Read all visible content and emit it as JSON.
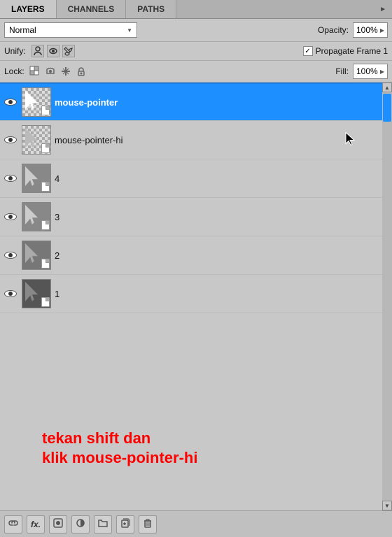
{
  "tabs": [
    {
      "id": "layers",
      "label": "LAYERS",
      "active": true
    },
    {
      "id": "channels",
      "label": "CHANNELS",
      "active": false
    },
    {
      "id": "paths",
      "label": "PATHS",
      "active": false
    }
  ],
  "blend_mode": {
    "value": "Normal",
    "arrow": "▼"
  },
  "opacity": {
    "label": "Opacity:",
    "value": "100%",
    "arrow": "▶"
  },
  "unify": {
    "label": "Unify:",
    "icons": [
      "person-icon",
      "eye-icon",
      "brush-icon"
    ]
  },
  "propagate": {
    "label": "Propagate Frame 1",
    "checked": true,
    "checkmark": "✓"
  },
  "lock": {
    "label": "Lock:",
    "icons": [
      "checkerboard-icon",
      "brush-icon",
      "move-icon",
      "lock-icon"
    ]
  },
  "fill": {
    "label": "Fill:",
    "value": "100%",
    "arrow": "▶"
  },
  "layers": [
    {
      "id": "mouse-pointer",
      "name": "mouse-pointer",
      "selected": true,
      "visible": true,
      "thumb_type": "white_pointer"
    },
    {
      "id": "mouse-pointer-hi",
      "name": "mouse-pointer-hi",
      "selected": false,
      "visible": true,
      "thumb_type": "gray_checker_pointer",
      "has_cursor": true
    },
    {
      "id": "4",
      "name": "4",
      "selected": false,
      "visible": true,
      "thumb_type": "dark_pointer"
    },
    {
      "id": "3",
      "name": "3",
      "selected": false,
      "visible": true,
      "thumb_type": "dark_pointer"
    },
    {
      "id": "2",
      "name": "2",
      "selected": false,
      "visible": true,
      "thumb_type": "dark_pointer"
    },
    {
      "id": "1",
      "name": "1",
      "selected": false,
      "visible": true,
      "thumb_type": "darker_pointer"
    }
  ],
  "instruction": {
    "line1": "tekan shift dan",
    "line2": "klik mouse-pointer-hi"
  },
  "toolbar": {
    "link_label": "🔗",
    "fx_label": "fx.",
    "circle_half_label": "◑",
    "adjustment_label": "◎",
    "folder_label": "□",
    "trash_label": "🗑",
    "new_layer_label": "📄"
  },
  "scroll": {
    "up_arrow": "▲",
    "down_arrow": "▼"
  }
}
